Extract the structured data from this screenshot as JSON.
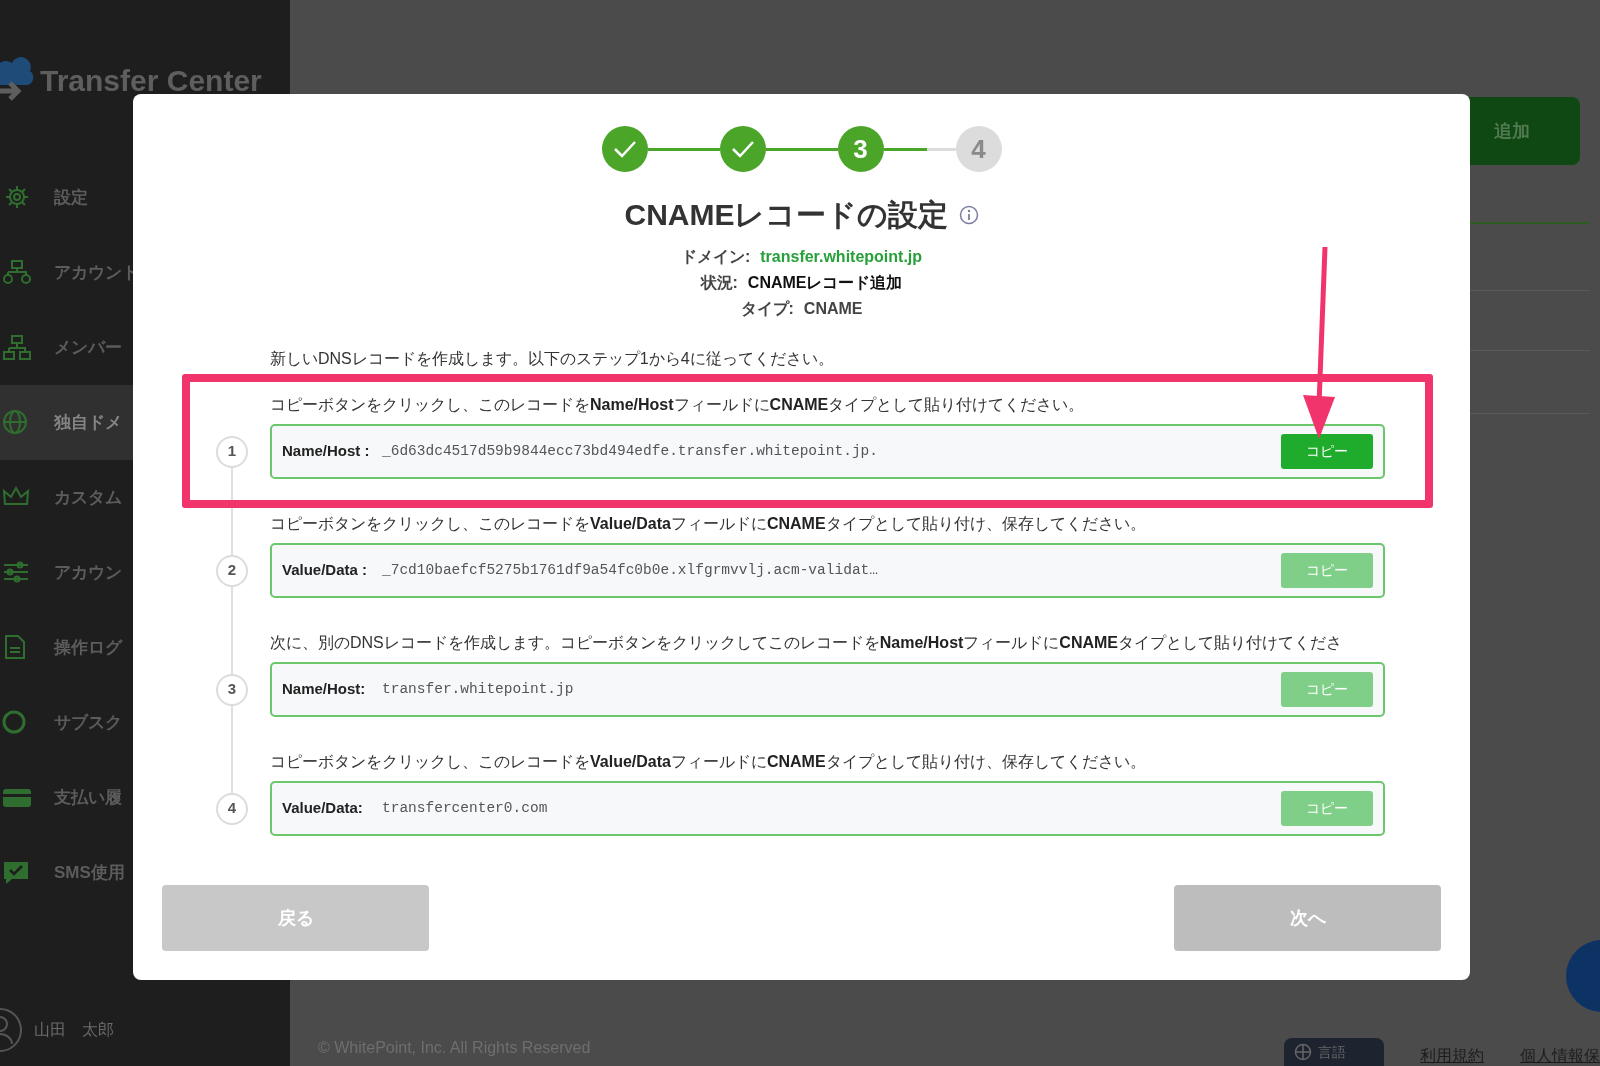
{
  "sidebar": {
    "logo": "Transfer Center",
    "items": [
      {
        "label": "設定",
        "selected": false
      },
      {
        "label": "アカウント",
        "selected": false
      },
      {
        "label": "メンバー",
        "selected": false
      },
      {
        "label": "独自ドメ",
        "selected": true
      },
      {
        "label": "カスタム",
        "selected": false
      },
      {
        "label": "アカウン",
        "selected": false
      },
      {
        "label": "操作ログ",
        "selected": false
      },
      {
        "label": "サブスク",
        "selected": false
      },
      {
        "label": "支払い履",
        "selected": false
      },
      {
        "label": "SMS使用",
        "selected": false
      }
    ],
    "user": "山田　太郎"
  },
  "page": {
    "add_button": "追加",
    "footer": {
      "copyright": "© WhitePoint, Inc. All Rights Reserved",
      "language_button": "言語",
      "links": [
        "利用規約",
        "個人情報保"
      ]
    }
  },
  "modal": {
    "steps": [
      {
        "done": true,
        "selected": false
      },
      {
        "done": true,
        "selected": false
      },
      {
        "done": false,
        "selected": true,
        "label": "3"
      },
      {
        "done": false,
        "selected": false,
        "label": "4"
      }
    ],
    "title": "CNAMEレコードの設定",
    "meta": [
      {
        "label": "ドメイン:",
        "value": "transfer.whitepoint.jp",
        "kind": "link"
      },
      {
        "label": "状況:",
        "value": "CNAMEレコード追加",
        "kind": "strong"
      },
      {
        "label": "タイプ:",
        "value": "CNAME",
        "kind": "plain"
      }
    ],
    "intro": "新しいDNSレコードを作成します。以下のステップ1から4に従ってください。",
    "records": [
      {
        "number": "1",
        "instruction": "コピーボタンをクリックし、このレコードを**Name/Host**フィールドに**CNAME**タイプとして貼り付けてください。",
        "label": "Name/Host :",
        "value": "_6d63dc4517d59b9844ecc73bd494edfe.transfer.whitepoint.jp.",
        "copy_button": "コピー",
        "disabled": false,
        "highlighted": true
      },
      {
        "number": "2",
        "instruction": "コピーボタンをクリックし、このレコードを**Value/Data**フィールドに**CNAME**タイプとして貼り付け、保存してください。",
        "label": "Value/Data :",
        "value": "_7cd10baefcf5275b1761df9a54fc0b0e.xlfgrmvvlj.acm-validat…",
        "copy_button": "コピー",
        "disabled": true,
        "highlighted": false
      },
      {
        "number": "3",
        "instruction": "次に、別のDNSレコードを作成します。コピーボタンをクリックしてこのレコードを**Name/Host**フィールドに**CNAME**タイプとして貼り付けてくださ",
        "label": "Name/Host:",
        "value": "transfer.whitepoint.jp",
        "copy_button": "コピー",
        "disabled": true,
        "highlighted": false
      },
      {
        "number": "4",
        "instruction": "コピーボタンをクリックし、このレコードを**Value/Data**フィールドに**CNAME**タイプとして貼り付け、保存してください。",
        "label": "Value/Data:",
        "value": "transfercenter0.com",
        "copy_button": "コピー",
        "disabled": true,
        "highlighted": false
      }
    ],
    "back_button": "戻る",
    "next_button": {
      "label": "次へ",
      "disabled": true
    }
  }
}
